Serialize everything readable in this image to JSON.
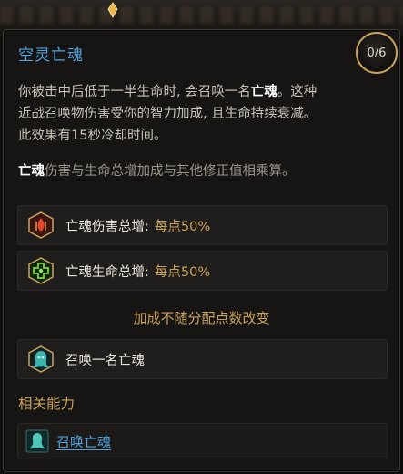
{
  "skill": {
    "title": "空灵亡魂",
    "rank": "0/6",
    "description": {
      "line1_pre": "你被击中后低于一半生命时, 会召唤一名",
      "line1_bold": "亡魂",
      "line1_post": "。这种",
      "line2": "近战召唤物伤害受你的智力加成, 且生命持续衰减。",
      "line3": "此效果有15秒冷却时间。"
    },
    "note": {
      "bold": "亡魂",
      "rest": "伤害与生命总增加成与其他修正值相乘算。"
    }
  },
  "modifiers": [
    {
      "label": "亡魂伤害总增:",
      "value": "每点50%",
      "icon": "flame-damage-icon"
    },
    {
      "label": "亡魂生命总增:",
      "value": "每点50%",
      "icon": "life-cross-icon"
    }
  ],
  "static_note": "加成不随分配点数改变",
  "grant": {
    "label": "召唤一名亡魂",
    "icon": "wraith-summon-icon"
  },
  "related": {
    "heading": "相关能力",
    "items": [
      {
        "label": "召唤亡魂",
        "icon": "wraith-skill-icon"
      }
    ]
  },
  "colors": {
    "title_blue": "#4fa3df",
    "gold": "#c9a25b",
    "text": "#c8c1b6",
    "muted": "#9b9489"
  }
}
